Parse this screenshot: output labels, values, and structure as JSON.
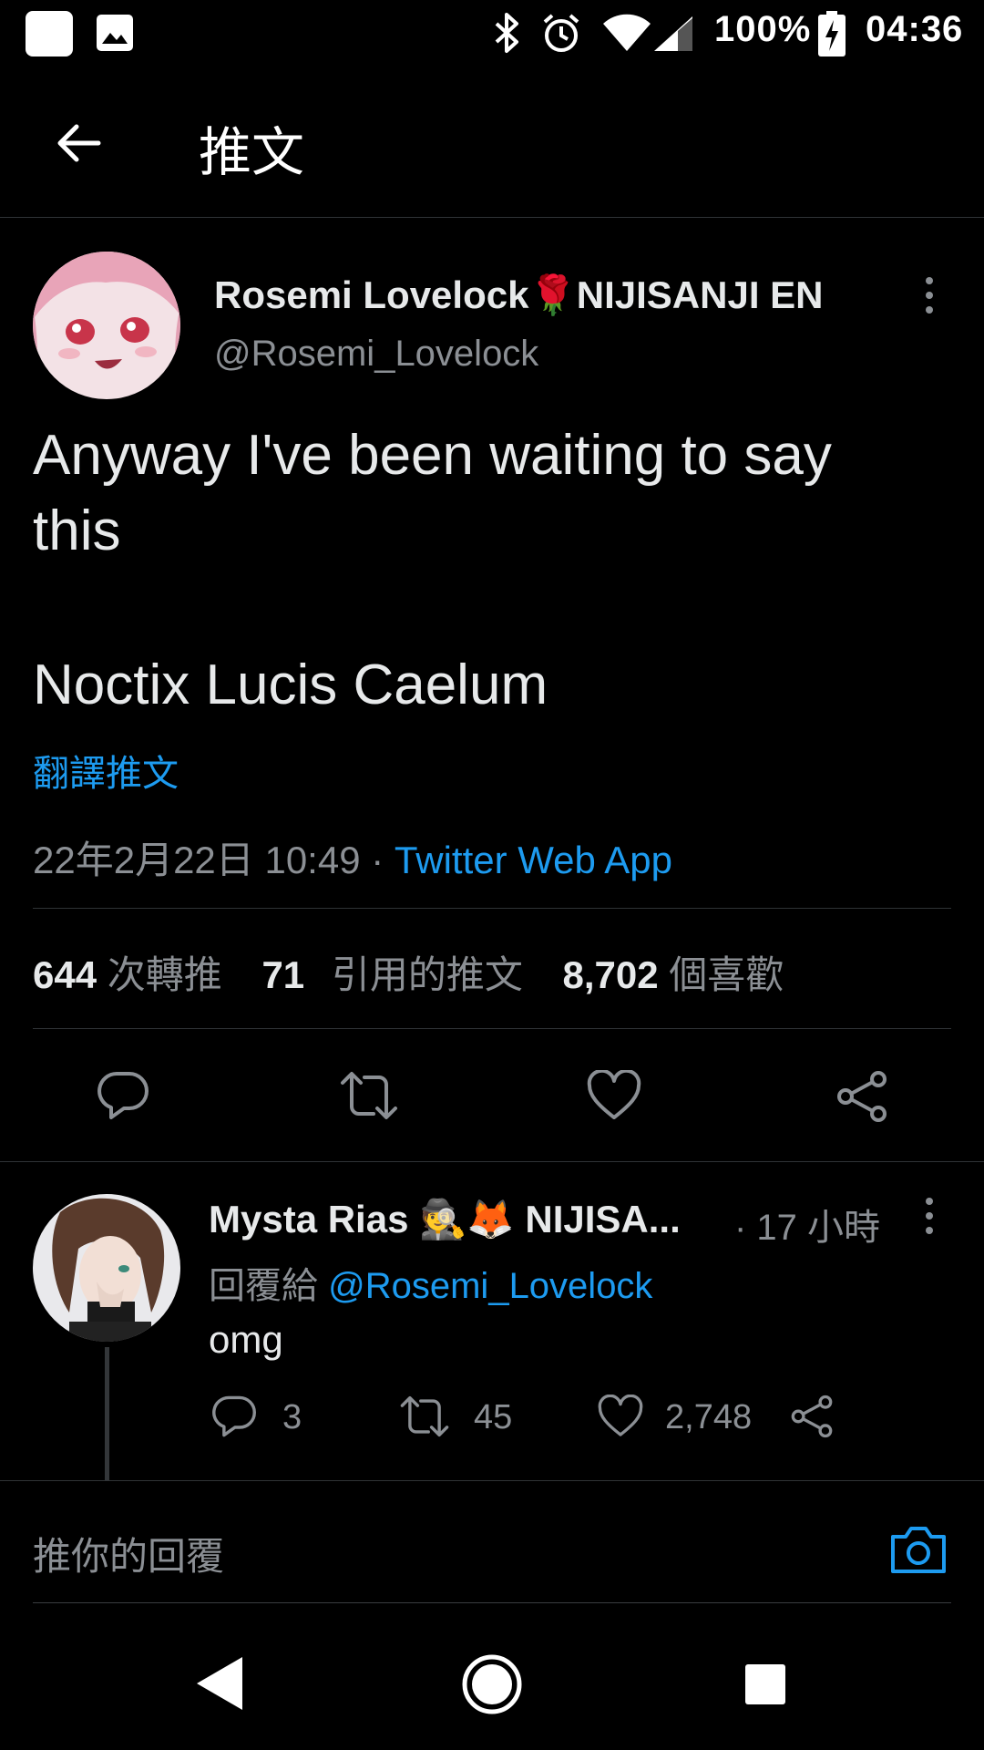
{
  "status_bar": {
    "battery": "100%",
    "time": "04:36",
    "icons": [
      "app-icon",
      "image-icon",
      "bluetooth-icon",
      "alarm-icon",
      "wifi-icon",
      "signal-icon",
      "battery-charging-icon"
    ]
  },
  "header": {
    "title": "推文",
    "back_icon": "arrow-left-icon"
  },
  "tweet": {
    "author_name": "Rosemi Lovelock",
    "author_emoji": "🌹",
    "author_suffix": "NIJISANJI EN",
    "handle": "@Rosemi_Lovelock",
    "text_line1": "Anyway I've been waiting to say",
    "text_line2": "this",
    "text_line3": "Noctix Lucis Caelum",
    "translate_label": "翻譯推文",
    "timestamp": "22年2月22日 10:49",
    "separator": "·",
    "source": "Twitter Web App",
    "stats": {
      "retweets": "644",
      "retweets_label": "次轉推",
      "quotes": "71",
      "quotes_label": "引用的推文",
      "likes": "8,702",
      "likes_label": "個喜歡"
    }
  },
  "reply": {
    "author_name": "Mysta Rias",
    "author_emoji": "🕵🦊",
    "author_suffix": "NIJISA...",
    "time": "· 17 小時",
    "replying_to_label": "回覆給",
    "replying_to_handle": "@Rosemi_Lovelock",
    "text": "omg",
    "reply_count": "3",
    "retweet_count": "45",
    "like_count": "2,748"
  },
  "composer": {
    "placeholder": "推你的回覆"
  },
  "colors": {
    "background": "#000000",
    "accent": "#1d9bf0",
    "text": "#e7e9ea",
    "muted": "#8b8f94",
    "divider": "#2f3336"
  }
}
